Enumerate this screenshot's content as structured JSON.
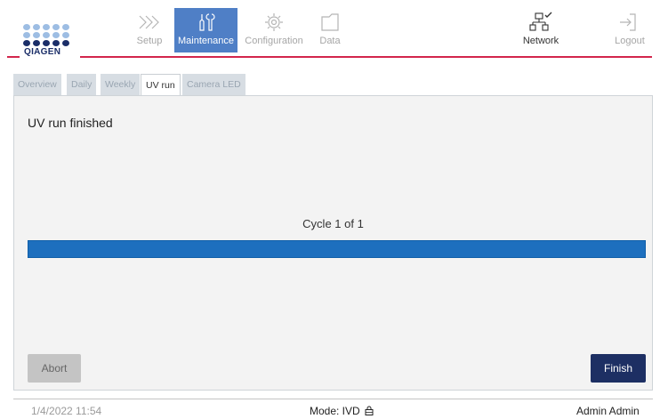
{
  "brand": {
    "name": "QIAGEN",
    "dot_color": "#9dbde3",
    "dot_color_dark": "#1b2e68",
    "line_color": "#d3264c"
  },
  "nav": {
    "setup": "Setup",
    "maintenance": "Maintenance",
    "configuration": "Configuration",
    "data": "Data",
    "network": "Network",
    "logout": "Logout"
  },
  "tabs": [
    "Overview",
    "Daily",
    "Weekly",
    "UV run",
    "Camera LED"
  ],
  "active_tab": "UV run",
  "panel": {
    "title": "UV run finished",
    "cycle_text": "Cycle 1 of 1",
    "progress_percent": 100
  },
  "buttons": {
    "abort": "Abort",
    "finish": "Finish"
  },
  "footer": {
    "datetime": "1/4/2022 11:54",
    "mode": "Mode: IVD",
    "user": "Admin Admin"
  },
  "colors": {
    "accent": "#4f7fc6",
    "progress": "#1d6fbe",
    "finish_button": "#1d2f63"
  }
}
